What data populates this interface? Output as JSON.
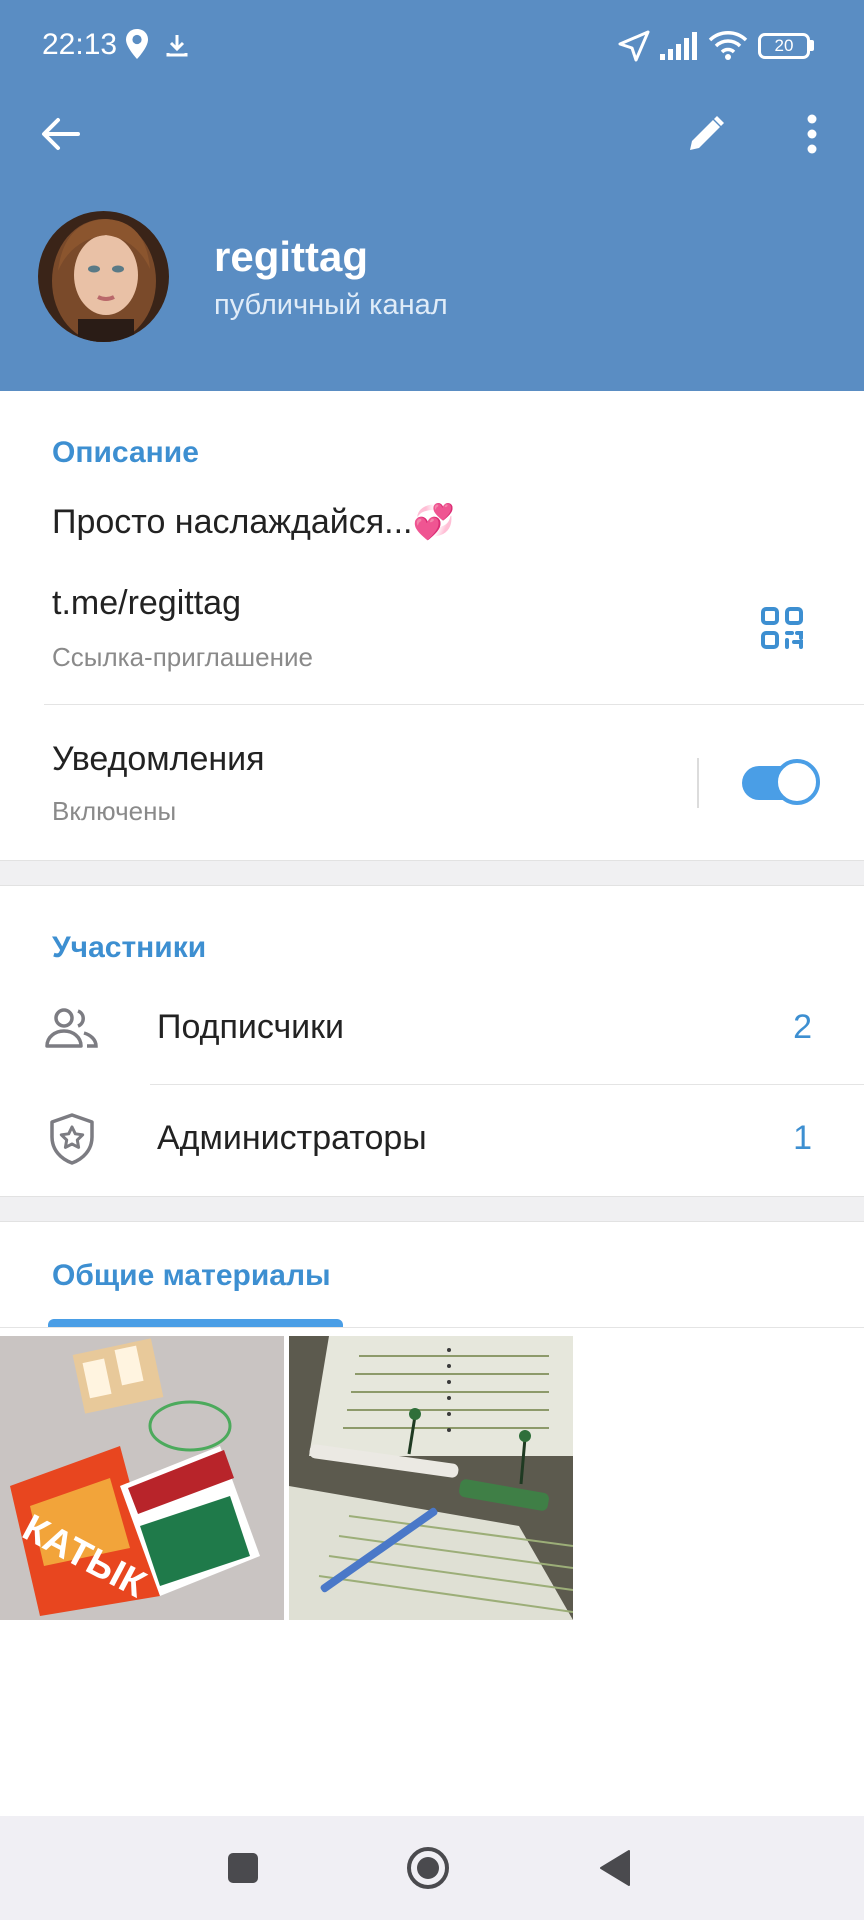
{
  "status_bar": {
    "time": "22:13",
    "battery": "20",
    "icons": [
      "location-pin-icon",
      "download-icon",
      "navigation-arrow-icon",
      "signal-icon",
      "wifi-icon",
      "battery-icon"
    ]
  },
  "header": {
    "back_icon": "back-arrow-icon",
    "edit_icon": "pencil-icon",
    "more_icon": "more-vertical-icon",
    "channel_name": "regittag",
    "channel_type": "публичный канал",
    "background_color": "#5a8dc3"
  },
  "info": {
    "section_title": "Описание",
    "description": "Просто наслаждайся...💞",
    "link": "t.me/regittag",
    "link_caption": "Ссылка-приглашение",
    "qr_icon": "qr-code-icon"
  },
  "notifications": {
    "label": "Уведомления",
    "status": "Включены",
    "enabled": true
  },
  "members": {
    "section_title": "Участники",
    "rows": [
      {
        "label": "Подписчики",
        "count": "2",
        "icon": "people-icon"
      },
      {
        "label": "Администраторы",
        "count": "1",
        "icon": "admin-shield-icon"
      }
    ]
  },
  "media": {
    "section_title": "Общие материалы",
    "items": [
      "photo-snacks",
      "photo-notebooks"
    ]
  },
  "navbar": {
    "icons": [
      "recent-apps-icon",
      "home-icon",
      "back-triangle-icon"
    ]
  },
  "colors": {
    "accent": "#3d8fd1",
    "toggle": "#4a9ee6"
  }
}
